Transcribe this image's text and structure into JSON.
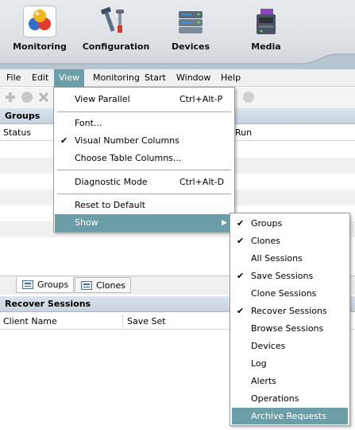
{
  "toolbar": {
    "monitoring": "Monitoring",
    "configuration": "Configuration",
    "devices": "Devices",
    "media": "Media"
  },
  "menubar": {
    "file": "File",
    "edit": "Edit",
    "view": "View",
    "monitoring": "Monitoring",
    "start": "Start",
    "window": "Window",
    "help": "Help"
  },
  "groups_panel": {
    "title": "Groups",
    "col_status": "Status",
    "col_run": "Run"
  },
  "tabs": {
    "groups": "Groups",
    "clones": "Clones"
  },
  "recover_panel": {
    "title": "Recover Sessions",
    "col_client": "Client Name",
    "col_saveset": "Save Set"
  },
  "view_menu": {
    "view_parallel": "View Parallel",
    "view_parallel_shortcut": "Ctrl+Alt-P",
    "font": "Font...",
    "visual_number_columns": "Visual Number Columns",
    "choose_table_columns": "Choose Table Columns...",
    "diagnostic_mode": "Diagnostic Mode",
    "diagnostic_mode_shortcut": "Ctrl+Alt-D",
    "reset_to_default": "Reset to Default",
    "show": "Show"
  },
  "show_menu": {
    "groups": "Groups",
    "clones": "Clones",
    "all_sessions": "All Sessions",
    "save_sessions": "Save Sessions",
    "clone_sessions": "Clone Sessions",
    "recover_sessions": "Recover Sessions",
    "browse_sessions": "Browse Sessions",
    "devices": "Devices",
    "log": "Log",
    "alerts": "Alerts",
    "operations": "Operations",
    "archive_requests": "Archive Requests"
  },
  "colors": {
    "highlight": "#6c9ea7",
    "header_gradient_top": "#dbe3ec",
    "toolbar_bg": "#dde1e5"
  },
  "icons": {
    "monitoring": "monitoring-molecule-icon",
    "configuration": "configuration-tools-icon",
    "devices": "devices-server-icon",
    "media": "media-storage-icon",
    "check": "checkmark-icon"
  }
}
